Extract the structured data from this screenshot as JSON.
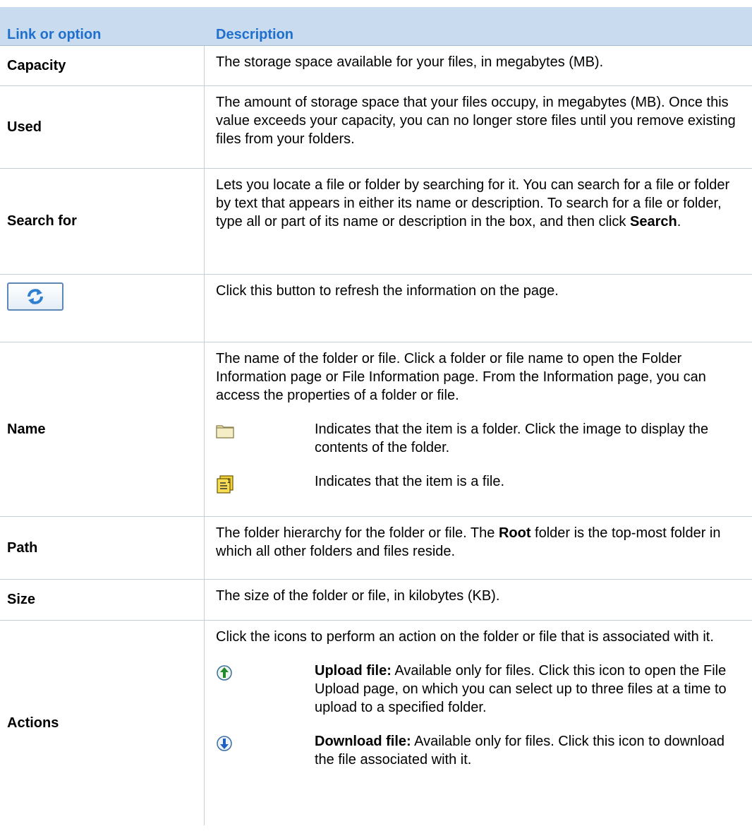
{
  "header": {
    "col1": "Link or option",
    "col2": "Description"
  },
  "rows": {
    "capacity": {
      "label": "Capacity",
      "desc": "The storage space available for your files, in megabytes (MB)."
    },
    "used": {
      "label": "Used",
      "desc": "The amount of storage space that your files occupy, in megabytes (MB). Once this value exceeds your capacity, you can no longer store files until you remove existing files from your folders."
    },
    "search": {
      "label": "Search for",
      "desc_pre": "Lets you locate a file or folder by searching for it. You can search for a file or folder by text that appears in either its name or description. To search for a file or folder, type all or part of its name or description in the box, and then click ",
      "desc_bold": "Search",
      "desc_post": "."
    },
    "refresh": {
      "icon": "refresh-icon",
      "desc": "Click this button to refresh the information on the page."
    },
    "name": {
      "label": "Name",
      "desc": "The name of the folder or file. Click a folder or file name to open the Folder Information page or File Information page. From the Information page, you can access the properties of a folder or file.",
      "folder_icon": "folder-icon",
      "folder_desc": "Indicates that the item is a folder. Click the image to display the contents of the folder.",
      "file_icon": "file-icon",
      "file_desc": "Indicates that the item is a file."
    },
    "path": {
      "label": "Path",
      "desc_pre": "The folder hierarchy for the folder or file. The ",
      "desc_bold": "Root",
      "desc_post": " folder is the top-most folder in which all other folders and files reside."
    },
    "size": {
      "label": "Size",
      "desc": "The size of the folder or file, in kilobytes (KB)."
    },
    "actions": {
      "label": "Actions",
      "desc": "Click the icons to perform an action on the folder or file that is associated with it.",
      "upload_icon": "upload-icon",
      "upload_bold": "Upload file:",
      "upload_desc": " Available only for files. Click this icon to open the File Upload page, on which you can select up to three files at a time to upload to a specified folder.",
      "download_icon": "download-icon",
      "download_bold": "Download file:",
      "download_desc": " Available only for files. Click this icon to download the file associated with it."
    }
  },
  "colors": {
    "header_bg": "#c9dcef",
    "header_text": "#1f6fce",
    "grid": "#c6cfd8"
  }
}
